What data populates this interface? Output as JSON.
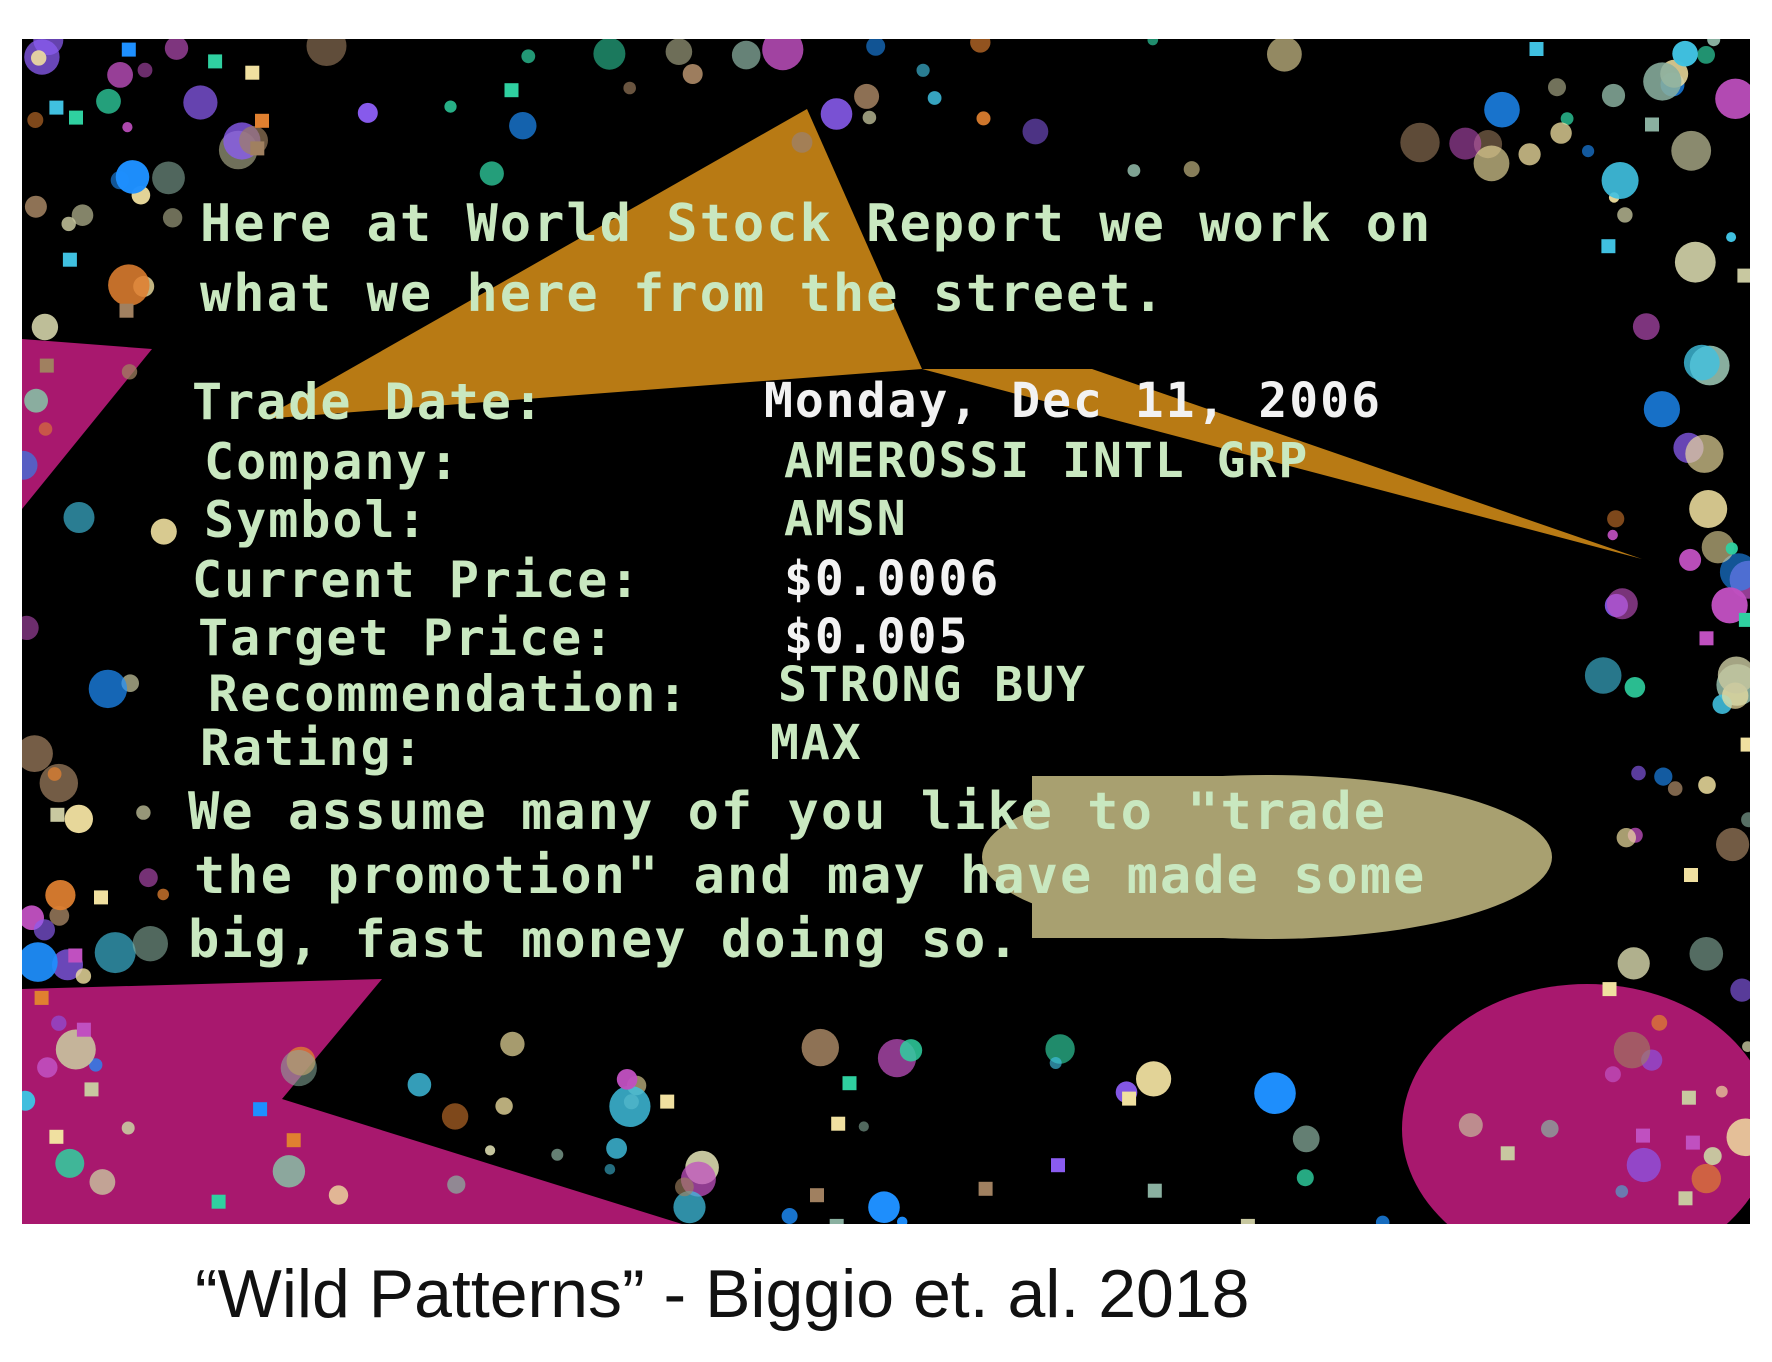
{
  "spam_image": {
    "intro_lines": [
      "Here at World Stock Report we work on",
      "what we here from the street."
    ],
    "fields": [
      {
        "label": "Trade Date:",
        "value": "Monday, Dec 11, 2006"
      },
      {
        "label": "Company:",
        "value": "AMEROSSI INTL GRP"
      },
      {
        "label": "Symbol:",
        "value": "AMSN"
      },
      {
        "label": "Current Price:",
        "value": "$0.0006"
      },
      {
        "label": "Target Price:",
        "value": "$0.005"
      },
      {
        "label": "Recommendation:",
        "value": "STRONG BUY"
      },
      {
        "label": "Rating:",
        "value": "MAX"
      }
    ],
    "outro_lines": [
      "We assume many of you like to \"trade",
      "the promotion\" and may have made some",
      "big, fast money doing so."
    ]
  },
  "caption": "“Wild Patterns” - Biggio et. al. 2018",
  "colors": {
    "background": "#000000",
    "text": "#c9e8c0",
    "orange_triangle": "#b87a14",
    "magenta_shapes": "#a8186e",
    "khaki_ellipse": "#a8a070"
  }
}
